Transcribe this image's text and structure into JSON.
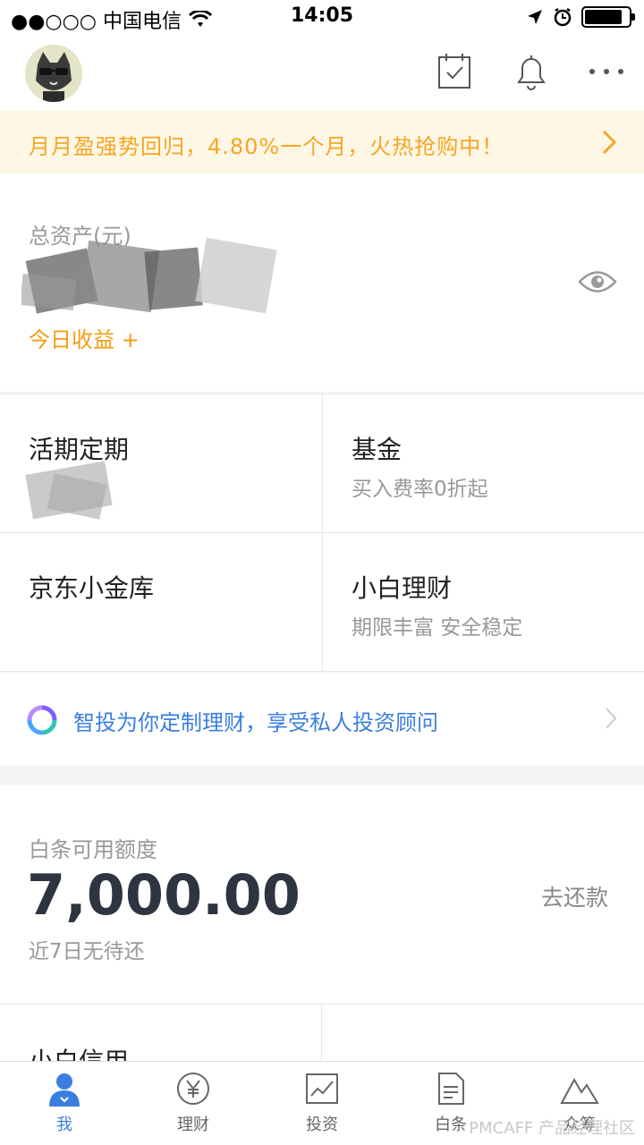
{
  "status_bar": {
    "carrier": "●●○○○ 中国电信",
    "time": "14:05",
    "battery_level": 0.85
  },
  "header": {
    "icons": [
      "calendar-check-icon",
      "bell-icon",
      "more-icon"
    ]
  },
  "banner": {
    "text": "月月盈强势回归，4.80%一个月，火热抢购中！"
  },
  "assets": {
    "label": "总资产(元)",
    "today_label": "今日收益 +"
  },
  "products": [
    {
      "title": "活期定期",
      "subtitle": ""
    },
    {
      "title": "基金",
      "subtitle": "买入费率0折起"
    },
    {
      "title": "京东小金库",
      "subtitle": ""
    },
    {
      "title": "小白理财",
      "subtitle": "期限丰富 安全稳定"
    }
  ],
  "advisor": {
    "text": "智投为你定制理财，享受私人投资顾问"
  },
  "credit": {
    "label": "白条可用额度",
    "amount": "7,000.00",
    "note": "近7日无待还",
    "repay": "去还款",
    "next_title": "小白信用"
  },
  "tabs": [
    {
      "label": "我",
      "icon": "user-icon",
      "active": true
    },
    {
      "label": "理财",
      "icon": "yen-icon",
      "active": false
    },
    {
      "label": "投资",
      "icon": "chart-icon",
      "active": false
    },
    {
      "label": "白条",
      "icon": "document-icon",
      "active": false
    },
    {
      "label": "众筹",
      "icon": "mountain-icon",
      "active": false
    }
  ],
  "watermark": "PMCAFF 产品经理社区",
  "colors": {
    "accent_blue": "#3b7ee0",
    "accent_orange": "#f5a623",
    "banner_bg": "#fff7e6"
  }
}
